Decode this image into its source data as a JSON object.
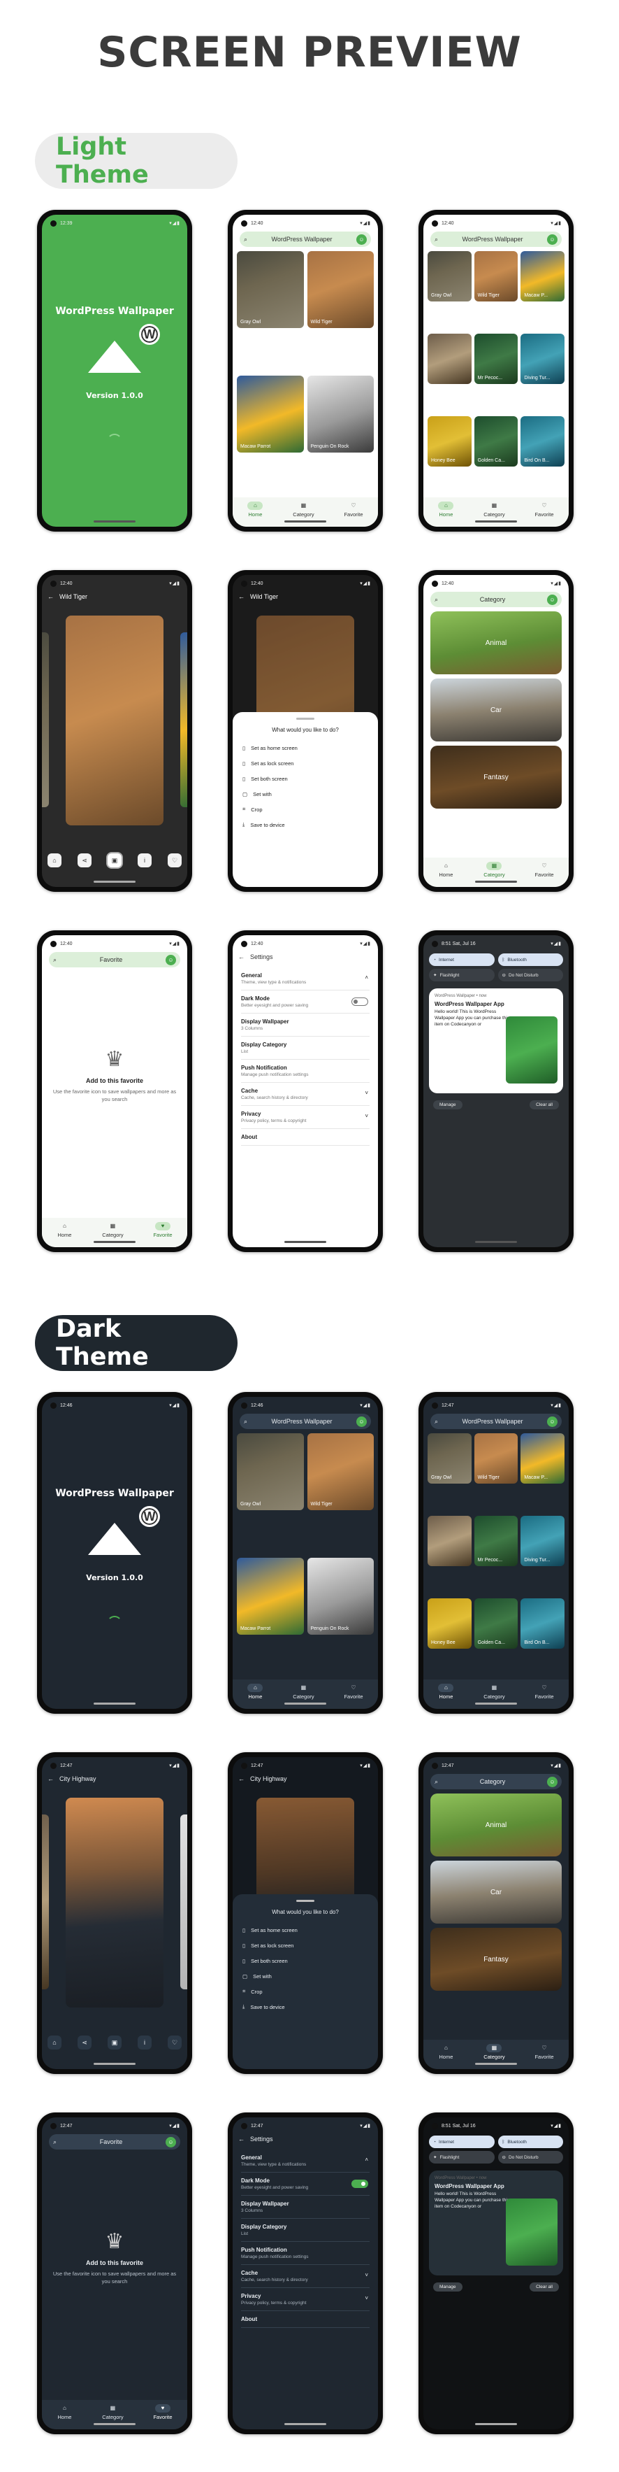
{
  "page_title": "SCREEN PREVIEW",
  "sections": {
    "light_label": "Light Theme",
    "dark_label": "Dark Theme"
  },
  "status": {
    "light": [
      "12:39",
      "12:40",
      "12:40",
      "12:40",
      "12:40",
      "12:40",
      "12:40",
      "12:40"
    ],
    "dark": [
      "12:46",
      "12:46",
      "12:47",
      "12:47",
      "12:47",
      "12:47",
      "12:47",
      "12:47"
    ],
    "shade_time": "8:51 Sat, Jul 16"
  },
  "splash": {
    "title": "WordPress Wallpaper",
    "version": "Version 1.0.0"
  },
  "search": {
    "placeholder": "WordPress Wallpaper"
  },
  "wallpapers_2col": [
    "Gray Owl",
    "Wild Tiger",
    "Macaw Parrot",
    "Penguin On Rock"
  ],
  "wallpapers_3col": [
    "Gray Owl",
    "Wild Tiger",
    "Macaw P...",
    "",
    "Mr Pecoc...",
    "Diving Tur...",
    "Honey Bee",
    "Golden Ca...",
    "Bird On B..."
  ],
  "nav": {
    "home": "Home",
    "category": "Category",
    "favorite": "Favorite"
  },
  "detail": {
    "light_title": "Wild Tiger",
    "dark_title": "City Highway"
  },
  "sheet": {
    "title": "What would you like to do?",
    "items": [
      "Set as home screen",
      "Set as lock screen",
      "Set both screen",
      "Set with",
      "Crop",
      "Save to device"
    ]
  },
  "category": {
    "title": "Category",
    "cards": [
      "Animal",
      "Car",
      "Fantasy"
    ]
  },
  "favorite": {
    "title": "Favorite",
    "empty_heading": "Add to this favorite",
    "empty_text": "Use the favorite icon to save wallpapers and more as you search"
  },
  "settings": {
    "title": "Settings",
    "items": [
      {
        "title": "General",
        "sub": "Theme, view type & notifications"
      },
      {
        "title": "Dark Mode",
        "sub": "Better eyesight and power saving"
      },
      {
        "title": "Display Wallpaper",
        "sub": "3 Columns"
      },
      {
        "title": "Display Category",
        "sub": "List"
      },
      {
        "title": "Push Notification",
        "sub": "Manage push notification settings"
      },
      {
        "title": "Cache",
        "sub": "Cache, search history & directory"
      },
      {
        "title": "Privacy",
        "sub": "Privacy policy, terms & copyright"
      },
      {
        "title": "About",
        "sub": ""
      }
    ]
  },
  "shade": {
    "tiles": [
      "Internet",
      "Bluetooth",
      "Flashlight",
      "Do Not Disturb"
    ],
    "app": "WordPress Wallpaper • now",
    "notif_title": "WordPress Wallpaper App",
    "notif_body": "Hello world! This is WordPress Wallpaper App you can purchase this item on Codecanyon or",
    "manage": "Manage",
    "clear": "Clear all"
  }
}
